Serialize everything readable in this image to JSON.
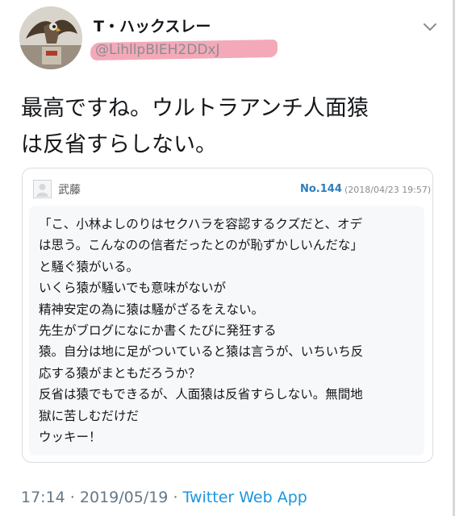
{
  "user": {
    "display_name": "T・ハックスレー",
    "handle": "@LihllpBIEH2DDxJ"
  },
  "tweet": {
    "text_lines": [
      "最高ですね。ウルトラアンチ人面猿",
      "は反省すらしない。"
    ]
  },
  "quoted_post": {
    "username": "武藤",
    "post_number": "No.144",
    "date": "(2018/04/23 19:57)",
    "body_lines": [
      "「こ、小林よしのりはセクハラを容認するクズだと、オデ",
      "は思う。こんなのの信者だったとのが恥ずかしいんだな」",
      "と騒ぐ猿がいる。",
      "いくら猿が騒いでも意味がないが",
      "精神安定の為に猿は騒がざるをえない。",
      "先生がブログになにか書くたびに発狂する",
      "猿。自分は地に足がついていると猿は言うが、いちいち反",
      "応する猿がまともだろうか？",
      "反省は猿でもできるが、人面猿は反省すらしない。無間地",
      "獄に苦しむだけだ",
      "ウッキー！"
    ]
  },
  "meta": {
    "time": "17:14",
    "separator1": " · ",
    "date": "2019/05/19",
    "separator2": " · ",
    "app": "Twitter Web App"
  },
  "colors": {
    "link": "#1b95e0",
    "post_number": "#2a7dbf",
    "handle_highlight": "#f3a9b8"
  },
  "icons": {
    "menu": "chevron-down-icon",
    "card_avatar": "default-avatar-icon"
  }
}
